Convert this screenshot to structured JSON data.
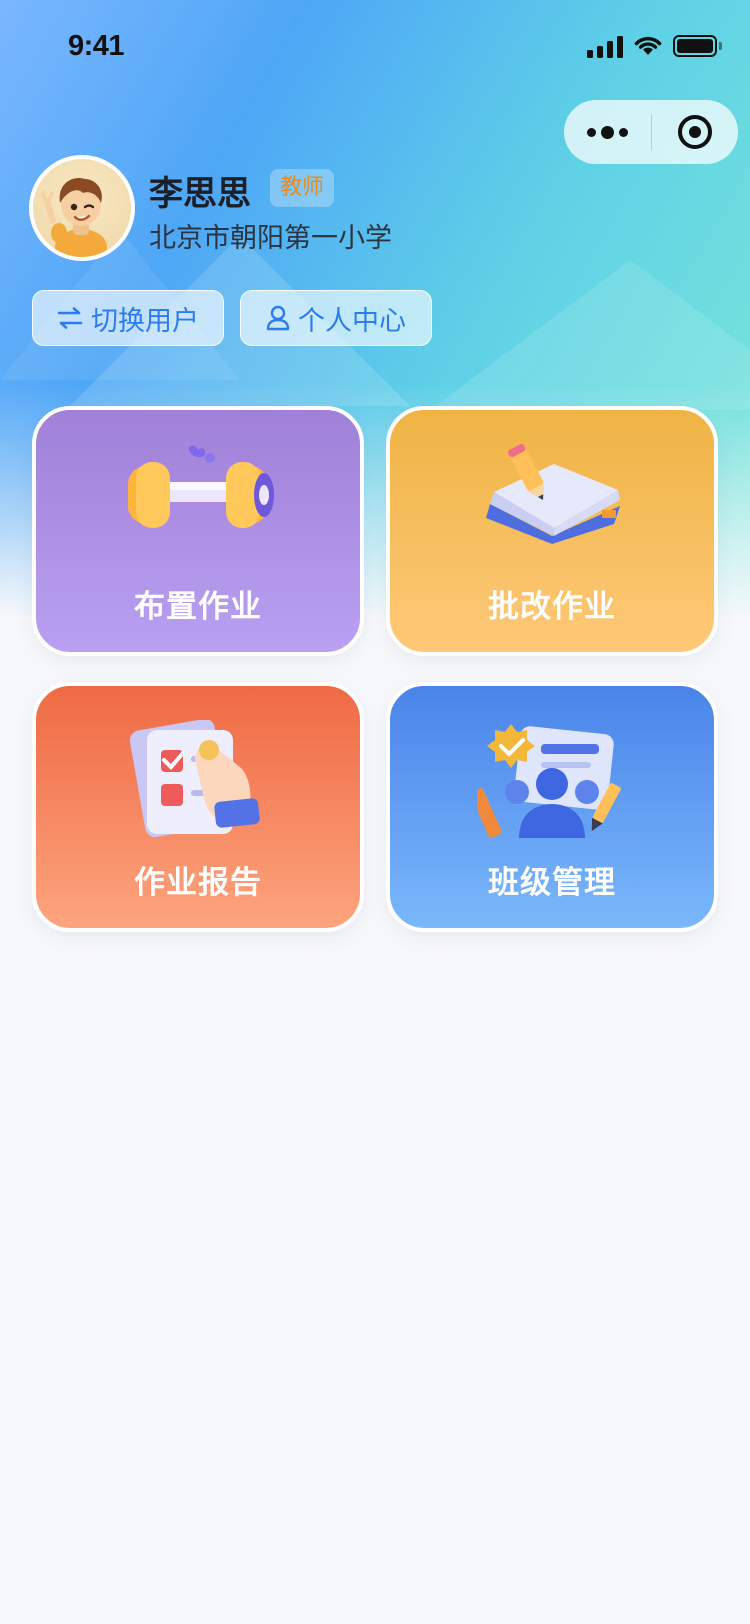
{
  "status_bar": {
    "time": "9:41"
  },
  "profile": {
    "name": "李思思",
    "role": "教师",
    "school": "北京市朝阳第一小学"
  },
  "actions": {
    "switch_user": "切换用户",
    "personal_center": "个人中心"
  },
  "cards": [
    {
      "label": "布置作业",
      "icon": "dumbbell-icon"
    },
    {
      "label": "批改作业",
      "icon": "notebook-pencil-icon"
    },
    {
      "label": "作业报告",
      "icon": "checklist-report-icon"
    },
    {
      "label": "班级管理",
      "icon": "class-people-icon"
    }
  ],
  "colors": {
    "accent_blue": "#2c7cf0",
    "role_badge_text": "#e58b1f",
    "card_assign": "#a080d8",
    "card_grade": "#efb444",
    "card_report": "#ee6a44",
    "card_class": "#4a84ea"
  }
}
